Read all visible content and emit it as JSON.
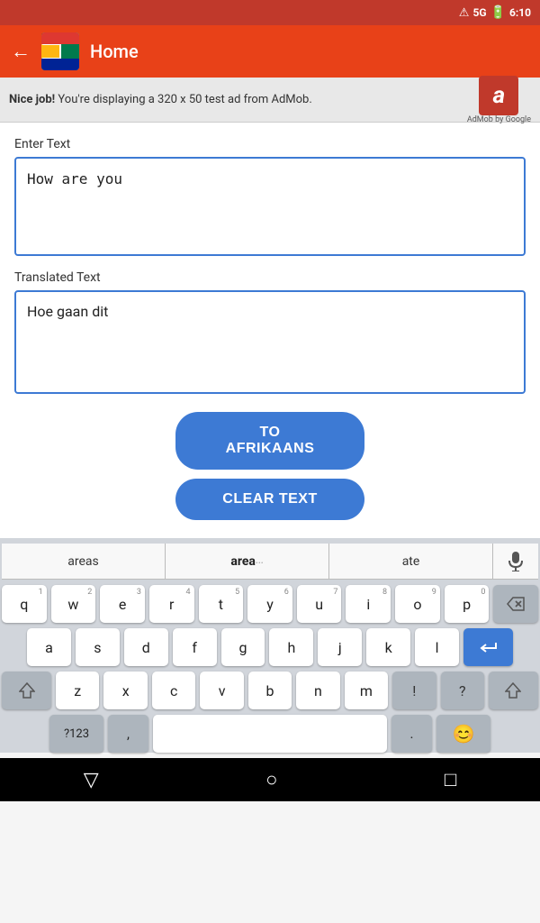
{
  "status_bar": {
    "warning_icon": "⚠",
    "signal": "5G",
    "battery": "🔋",
    "time": "6:10"
  },
  "top_bar": {
    "back_label": "←",
    "title": "Home"
  },
  "ad_banner": {
    "nice_label": "Nice job!",
    "ad_text": " You're displaying a 320 x 50 test ad from AdMob.",
    "admob_letter": "a",
    "admob_by": "AdMob by Google"
  },
  "main": {
    "enter_text_label": "Enter Text",
    "enter_text_value": "How are you",
    "translated_label": "Translated Text",
    "translated_value": "Hoe gaan dit"
  },
  "buttons": {
    "to_afrikaans": "TO AFRIKAANS",
    "clear_text": "CLEAR TEXT"
  },
  "keyboard": {
    "suggestions": [
      "areas",
      "area",
      "ate"
    ],
    "rows": [
      {
        "keys": [
          {
            "letter": "q",
            "number": "1"
          },
          {
            "letter": "w",
            "number": "2"
          },
          {
            "letter": "e",
            "number": "3"
          },
          {
            "letter": "r",
            "number": "4"
          },
          {
            "letter": "t",
            "number": "5"
          },
          {
            "letter": "y",
            "number": "6"
          },
          {
            "letter": "u",
            "number": "7"
          },
          {
            "letter": "i",
            "number": "8"
          },
          {
            "letter": "o",
            "number": "9"
          },
          {
            "letter": "p",
            "number": "0"
          }
        ]
      },
      {
        "keys": [
          {
            "letter": "a"
          },
          {
            "letter": "s"
          },
          {
            "letter": "d"
          },
          {
            "letter": "f"
          },
          {
            "letter": "g"
          },
          {
            "letter": "h"
          },
          {
            "letter": "j"
          },
          {
            "letter": "k"
          },
          {
            "letter": "l"
          }
        ]
      },
      {
        "keys": [
          {
            "letter": "z"
          },
          {
            "letter": "x"
          },
          {
            "letter": "c"
          },
          {
            "letter": "v"
          },
          {
            "letter": "b"
          },
          {
            "letter": "n"
          },
          {
            "letter": "m"
          }
        ]
      }
    ],
    "symbol_label": "?123",
    "comma": ",",
    "space_label": "",
    "period": ".",
    "emoji": "😊"
  },
  "nav_bar": {
    "back": "▽",
    "home": "○",
    "recents": "□"
  }
}
